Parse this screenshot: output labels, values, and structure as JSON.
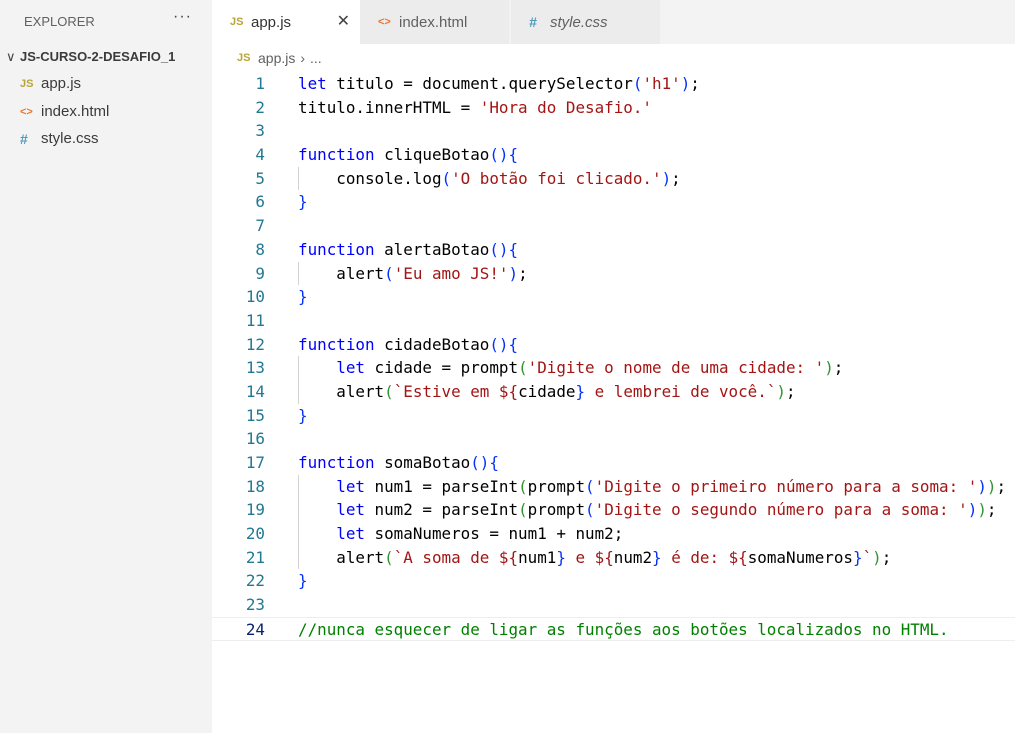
{
  "sidebar": {
    "title": "EXPLORER",
    "more": "···",
    "folder": "JS-CURSO-2-DESAFIO_1",
    "files": [
      {
        "icon": "JS",
        "name": "app.js"
      },
      {
        "icon": "<>",
        "name": "index.html"
      },
      {
        "icon": "#",
        "name": "style.css"
      }
    ]
  },
  "tabs": [
    {
      "icon": "JS",
      "label": "app.js",
      "close": "✕"
    },
    {
      "icon": "<>",
      "label": "index.html"
    },
    {
      "icon": "#",
      "label": "style.css"
    }
  ],
  "breadcrumb": {
    "icon": "JS",
    "file": "app.js",
    "sep": "›",
    "rest": "..."
  },
  "code": [
    [
      [
        "let",
        "k"
      ],
      [
        " titulo = document.querySelector",
        "p"
      ],
      [
        "(",
        "b1"
      ],
      [
        "'h1'",
        "s"
      ],
      [
        ")",
        "b1"
      ],
      [
        ";",
        "p"
      ]
    ],
    [
      [
        "titulo.innerHTML = ",
        "p"
      ],
      [
        "'Hora do Desafio.'",
        "s"
      ]
    ],
    [],
    [
      [
        "function",
        "k"
      ],
      [
        " cliqueBotao",
        "p"
      ],
      [
        "()",
        "b1"
      ],
      [
        "{",
        "b1"
      ]
    ],
    [
      [
        "    console.log",
        "p"
      ],
      [
        "(",
        "b1"
      ],
      [
        "'O botão foi clicado.'",
        "s"
      ],
      [
        ")",
        "b1"
      ],
      [
        ";",
        "p"
      ]
    ],
    [
      [
        "}",
        "b1"
      ]
    ],
    [],
    [
      [
        "function",
        "k"
      ],
      [
        " alertaBotao",
        "p"
      ],
      [
        "()",
        "b1"
      ],
      [
        "{",
        "b1"
      ]
    ],
    [
      [
        "    alert",
        "p"
      ],
      [
        "(",
        "b1"
      ],
      [
        "'Eu amo JS!'",
        "s"
      ],
      [
        ")",
        "b1"
      ],
      [
        ";",
        "p"
      ]
    ],
    [
      [
        "}",
        "b1"
      ]
    ],
    [],
    [
      [
        "function",
        "k"
      ],
      [
        " cidadeBotao",
        "p"
      ],
      [
        "()",
        "b1"
      ],
      [
        "{",
        "b1"
      ]
    ],
    [
      [
        "    ",
        "p"
      ],
      [
        "let",
        "k"
      ],
      [
        " cidade = prompt",
        "p"
      ],
      [
        "(",
        "b2"
      ],
      [
        "'Digite o nome de uma cidade: '",
        "s"
      ],
      [
        ")",
        "b2"
      ],
      [
        ";",
        "p"
      ]
    ],
    [
      [
        "    alert",
        "p"
      ],
      [
        "(",
        "b2"
      ],
      [
        "`Estive em ${",
        "s"
      ],
      [
        "cidade",
        "p"
      ],
      [
        "}",
        "b1"
      ],
      [
        " e lembrei de você.`",
        "s"
      ],
      [
        ")",
        "b2"
      ],
      [
        ";",
        "p"
      ]
    ],
    [
      [
        "}",
        "b1"
      ]
    ],
    [],
    [
      [
        "function",
        "k"
      ],
      [
        " somaBotao",
        "p"
      ],
      [
        "()",
        "b1"
      ],
      [
        "{",
        "b1"
      ]
    ],
    [
      [
        "    ",
        "p"
      ],
      [
        "let",
        "k"
      ],
      [
        " num1 = parseInt",
        "p"
      ],
      [
        "(",
        "b2"
      ],
      [
        "prompt",
        "p"
      ],
      [
        "(",
        "b1"
      ],
      [
        "'Digite o primeiro número para a soma: '",
        "s"
      ],
      [
        ")",
        "b1"
      ],
      [
        ")",
        "b2"
      ],
      [
        ";",
        "p"
      ]
    ],
    [
      [
        "    ",
        "p"
      ],
      [
        "let",
        "k"
      ],
      [
        " num2 = parseInt",
        "p"
      ],
      [
        "(",
        "b2"
      ],
      [
        "prompt",
        "p"
      ],
      [
        "(",
        "b1"
      ],
      [
        "'Digite o segundo número para a soma: '",
        "s"
      ],
      [
        ")",
        "b1"
      ],
      [
        ")",
        "b2"
      ],
      [
        ";",
        "p"
      ]
    ],
    [
      [
        "    ",
        "p"
      ],
      [
        "let",
        "k"
      ],
      [
        " somaNumeros = num1 + num2;",
        "p"
      ]
    ],
    [
      [
        "    alert",
        "p"
      ],
      [
        "(",
        "b2"
      ],
      [
        "`A soma de ${",
        "s"
      ],
      [
        "num1",
        "p"
      ],
      [
        "}",
        "b1"
      ],
      [
        " e ${",
        "s"
      ],
      [
        "num2",
        "p"
      ],
      [
        "}",
        "b1"
      ],
      [
        " é de: ${",
        "s"
      ],
      [
        "somaNumeros",
        "p"
      ],
      [
        "}",
        "b1"
      ],
      [
        "`",
        "s"
      ],
      [
        ")",
        "b2"
      ],
      [
        ";",
        "p"
      ]
    ],
    [
      [
        "}",
        "b1"
      ]
    ],
    [],
    [
      [
        "//nunca esquecer de ligar as funções aos botões localizados no HTML.",
        "c"
      ]
    ]
  ]
}
